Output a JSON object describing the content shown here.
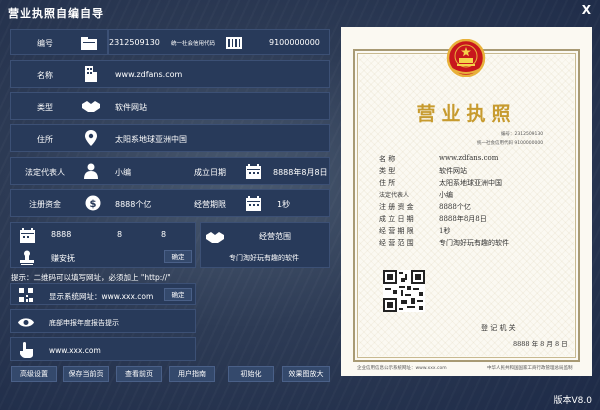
{
  "window": {
    "title": "营业执照自编自导",
    "close_label": "X",
    "version": "版本V8.0"
  },
  "form": {
    "code_label": "编号",
    "code_value": "2312509130",
    "credit_label": "统一社会信用代码",
    "credit_value": "9100000000",
    "name_label": "名称",
    "name_value": "www.zdfans.com",
    "type_label": "类型",
    "type_value": "软件网站",
    "address_label": "住所",
    "address_value": "太阳系地球亚洲中国",
    "legal_label": "法定代表人",
    "legal_value": "小编",
    "founded_label": "成立日期",
    "founded_value": "8888年8月8日",
    "capital_label": "注册资金",
    "capital_value": "8888个亿",
    "term_label": "经营期限",
    "term_value": "1秒",
    "date_year": "8888",
    "date_month": "8",
    "date_day": "8",
    "seal_label": "赚安抚",
    "confirm1": "确定",
    "scope_label": "经营范围",
    "scope_value": "专门淘好玩有趣的软件",
    "hint": "提示：二维码可以填写网址，必须加上 \"http://\"",
    "site_label": "显示系统网址：www.xxx.com",
    "confirm2": "确定",
    "report": "底部申报年度报告提示",
    "url": "www.xxx.com"
  },
  "buttons": [
    "高级设置",
    "保存当前页",
    "查看前页",
    "用户指南",
    "初始化",
    "效果图放大"
  ],
  "certificate": {
    "title": "营业执照",
    "serial_label": "编号：2312509130",
    "credit_line": "统一社会信用代码  9100000000",
    "rows": [
      {
        "k": "名          称",
        "v": "www.zdfans.com"
      },
      {
        "k": "类          型",
        "v": "软件网站"
      },
      {
        "k": "住          所",
        "v": "太阳系地球亚洲中国"
      },
      {
        "k": "法定代表人",
        "v": "小编"
      },
      {
        "k": "注 册 资 金",
        "v": "8888个亿"
      },
      {
        "k": "成 立 日 期",
        "v": "8888年8月8日"
      },
      {
        "k": "经 营 期 限",
        "v": "1秒"
      },
      {
        "k": "经 营 范 围",
        "v": "专门淘好玩有趣的软件"
      }
    ],
    "authority": "登 记 机 关",
    "date": "8888 年 8 月 8 日",
    "footer_left": "企业信用信息公示系统网址：www.xxx.com",
    "footer_right": "中华人民共和国国家工商行政管理总局监制"
  },
  "colors": {
    "panel": "#283a5a",
    "cert_title": "#c79b2f",
    "emblem_red": "#c8161d"
  }
}
